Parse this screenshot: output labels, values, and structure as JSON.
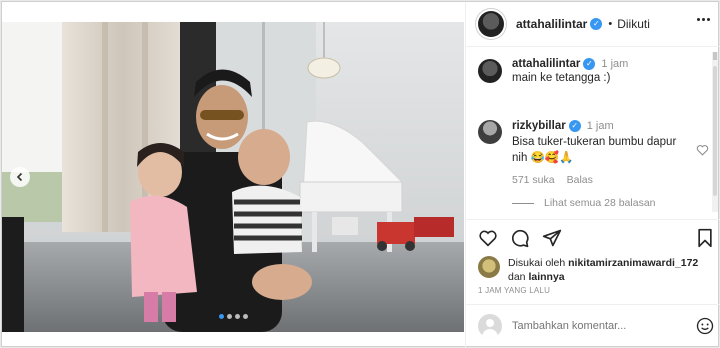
{
  "post": {
    "author": "attahalilintar",
    "follow_sep": "•",
    "follow_state": "Diikuti",
    "caption_time": "1 jam",
    "caption_text": "main ke tetangga :)"
  },
  "comment": {
    "author": "rizkybillar",
    "time": "1 jam",
    "text_line1": "Bisa tuker-tukeran bumbu dapur",
    "text_line2": "nih",
    "emojis": "😂🥰🙏",
    "likes": "571 suka",
    "reply_label": "Balas",
    "view_replies": "Lihat semua 28 balasan"
  },
  "likes_line": {
    "prefix": "Disukai oleh",
    "user": "nikitamirzanimawardi_172",
    "conj": "dan",
    "others": "lainnya"
  },
  "timestamp": "1 JAM YANG LALU",
  "comment_input": {
    "placeholder": "Tambahkan komentar..."
  },
  "carousel": {
    "count": 4,
    "active": 0
  },
  "colors": {
    "verified": "#3897f0",
    "link": "#00376b",
    "muted": "#8e8e8e"
  }
}
